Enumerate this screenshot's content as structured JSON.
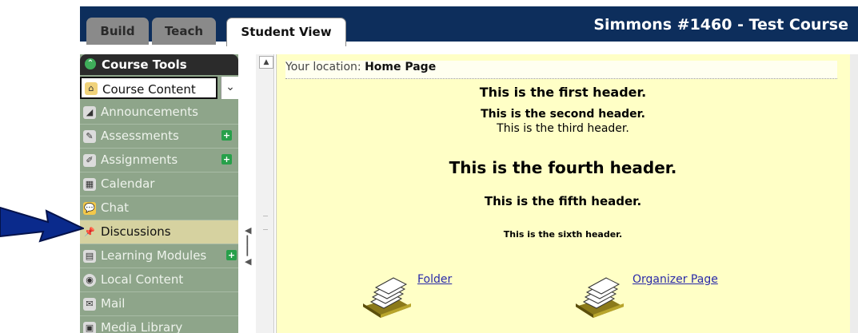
{
  "tabs": [
    {
      "label": "Build",
      "active": false
    },
    {
      "label": "Teach",
      "active": false
    },
    {
      "label": "Student View",
      "active": true
    }
  ],
  "course_title": "Simmons #1460 - Test Course",
  "sidebar": {
    "header": "Course Tools",
    "items": [
      {
        "label": "Course Content",
        "icon": "home-icon"
      },
      {
        "label": "Announcements",
        "icon": "megaphone-icon"
      },
      {
        "label": "Assessments",
        "icon": "assessment-icon",
        "new": true
      },
      {
        "label": "Assignments",
        "icon": "assignment-icon",
        "new": true
      },
      {
        "label": "Calendar",
        "icon": "calendar-icon"
      },
      {
        "label": "Chat",
        "icon": "chat-icon"
      },
      {
        "label": "Discussions",
        "icon": "pin-icon",
        "selected": true
      },
      {
        "label": "Learning Modules",
        "icon": "module-icon",
        "new": true
      },
      {
        "label": "Local Content",
        "icon": "disc-icon"
      },
      {
        "label": "Mail",
        "icon": "mail-icon"
      },
      {
        "label": "Media Library",
        "icon": "media-icon"
      }
    ]
  },
  "location": {
    "prefix": "Your location:",
    "page": "Home Page"
  },
  "headers": [
    "This is the first header.",
    "This is the second header.",
    "This is the third header.",
    "This is the fourth header.",
    "This is the fifth header.",
    "This is the sixth header."
  ],
  "links": [
    {
      "label": "Folder",
      "icon": "folder-tray-icon"
    },
    {
      "label": "Organizer Page",
      "icon": "organizer-tray-icon"
    }
  ],
  "colors": {
    "topbar": "#0d2e5c",
    "sidebar": "#8ea58a",
    "content_bg": "#ffffc6",
    "arrow": "#0a2a8c"
  }
}
